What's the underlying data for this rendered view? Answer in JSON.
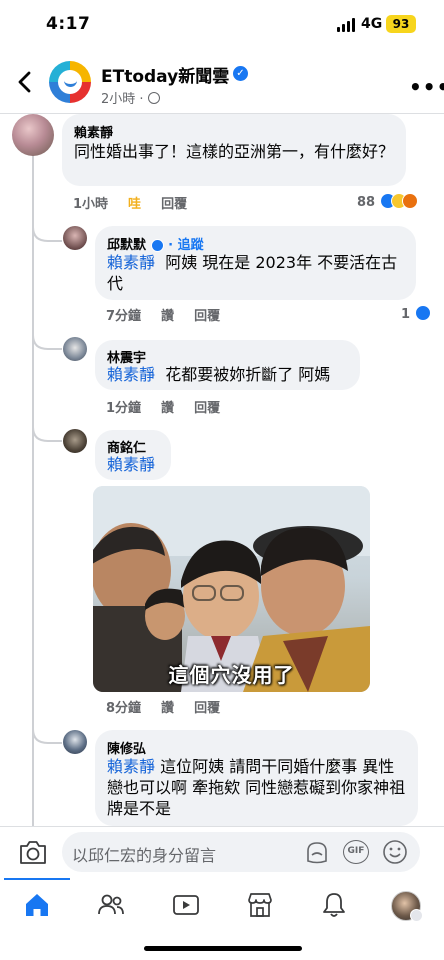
{
  "status_bar": {
    "time": "4:17",
    "network": "4G",
    "battery": "93"
  },
  "header": {
    "page_name": "ETtoday新聞雲",
    "post_time": "2小時"
  },
  "comments": [
    {
      "name": "賴素靜",
      "text": "同性婚出事了！這樣的亞洲第一，有什麼好？",
      "time": "1小時",
      "reaction_label": "哇",
      "reply_label": "回覆",
      "reaction_count": "88"
    },
    {
      "name": "邱默默",
      "follow_label": "追蹤",
      "mention": "賴素靜",
      "text": "阿姨 現在是 2023年 不要活在古代",
      "time": "7分鐘",
      "like_label": "讚",
      "reply_label": "回覆",
      "reaction_count": "1"
    },
    {
      "name": "林震宇",
      "mention": "賴素靜",
      "text": "花都要被妳折斷了 阿媽",
      "time": "1分鐘",
      "like_label": "讚",
      "reply_label": "回覆"
    },
    {
      "name": "商銘仁",
      "mention": "賴素靜",
      "image_caption": "這個穴沒用了",
      "time": "8分鐘",
      "like_label": "讚",
      "reply_label": "回覆"
    },
    {
      "name": "陳修弘",
      "mention": "賴素靜",
      "text": "這位阿姨 請問干同婚什麼事 異性戀也可以啊 牽拖欸 同性戀惹礙到你家神祖牌是不是"
    }
  ],
  "comment_input": {
    "placeholder": "以邱仁宏的身分留言"
  },
  "icons": {
    "reaction_icons": [
      "like-icon",
      "haha-icon",
      "angry-icon"
    ],
    "tabs": [
      "home-icon",
      "friends-icon",
      "video-icon",
      "marketplace-icon",
      "notifications-icon",
      "profile-icon"
    ]
  },
  "colors": {
    "accent": "#1877f2",
    "mention": "#1463d8",
    "bubble": "#f0f2f5",
    "wow": "#f2b01e"
  }
}
